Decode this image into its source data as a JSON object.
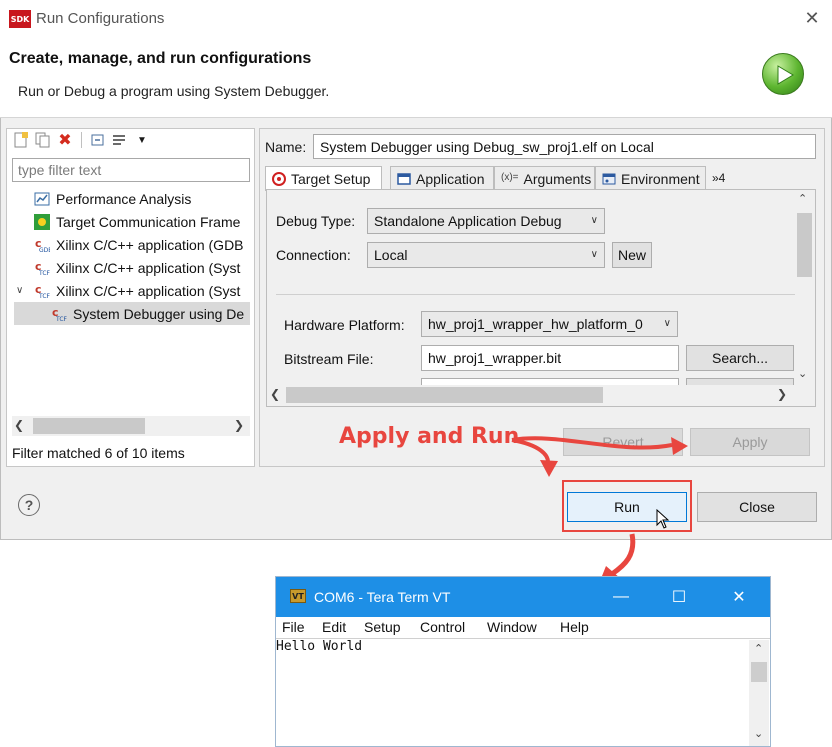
{
  "dialog": {
    "window_title": "Run Configurations",
    "sdk_badge": "SDK",
    "banner_title": "Create, manage, and run configurations",
    "banner_subtitle": "Run or Debug a program using System Debugger."
  },
  "left": {
    "filter_placeholder": "type filter text",
    "tree": [
      {
        "label": "Performance Analysis",
        "icon": "performance-icon"
      },
      {
        "label": "Target Communication Frame",
        "icon": "tcf-icon"
      },
      {
        "label": "Xilinx C/C++ application (GDB",
        "icon": "xilinx-gdb-icon"
      },
      {
        "label": "Xilinx C/C++ application (Syst",
        "icon": "xilinx-tcf-icon"
      },
      {
        "label": "Xilinx C/C++ application (Syst",
        "icon": "xilinx-tcf-icon",
        "expanded": true
      },
      {
        "label": "System Debugger using De",
        "icon": "xilinx-tcf-icon",
        "selected": true
      }
    ],
    "filter_status": "Filter matched 6 of 10 items"
  },
  "right": {
    "name_label": "Name:",
    "name_value": "System Debugger using Debug_sw_proj1.elf on Local",
    "tabs": [
      "Target Setup",
      "Application",
      "Arguments",
      "Environment"
    ],
    "tabs_overflow": "»4",
    "debug_type_label": "Debug Type:",
    "debug_type_value": "Standalone Application Debug",
    "connection_label": "Connection:",
    "connection_value": "Local",
    "new_button": "New",
    "hw_platform_label": "Hardware Platform:",
    "hw_platform_value": "hw_proj1_wrapper_hw_platform_0",
    "bitstream_label": "Bitstream File:",
    "bitstream_value": "hw_proj1_wrapper.bit",
    "search_button": "Search..."
  },
  "buttons": {
    "revert": "Revert",
    "apply": "Apply",
    "run": "Run",
    "close": "Close",
    "help": "?"
  },
  "annotation": {
    "text": "Apply and Run",
    "color": "#e8463f"
  },
  "teraterm": {
    "title": "COM6 - Tera Term VT",
    "icon_text": "VT",
    "menu": [
      "File",
      "Edit",
      "Setup",
      "Control",
      "Window",
      "Help"
    ],
    "console": "Hello World",
    "titlebar_color": "#1e8fe6"
  }
}
